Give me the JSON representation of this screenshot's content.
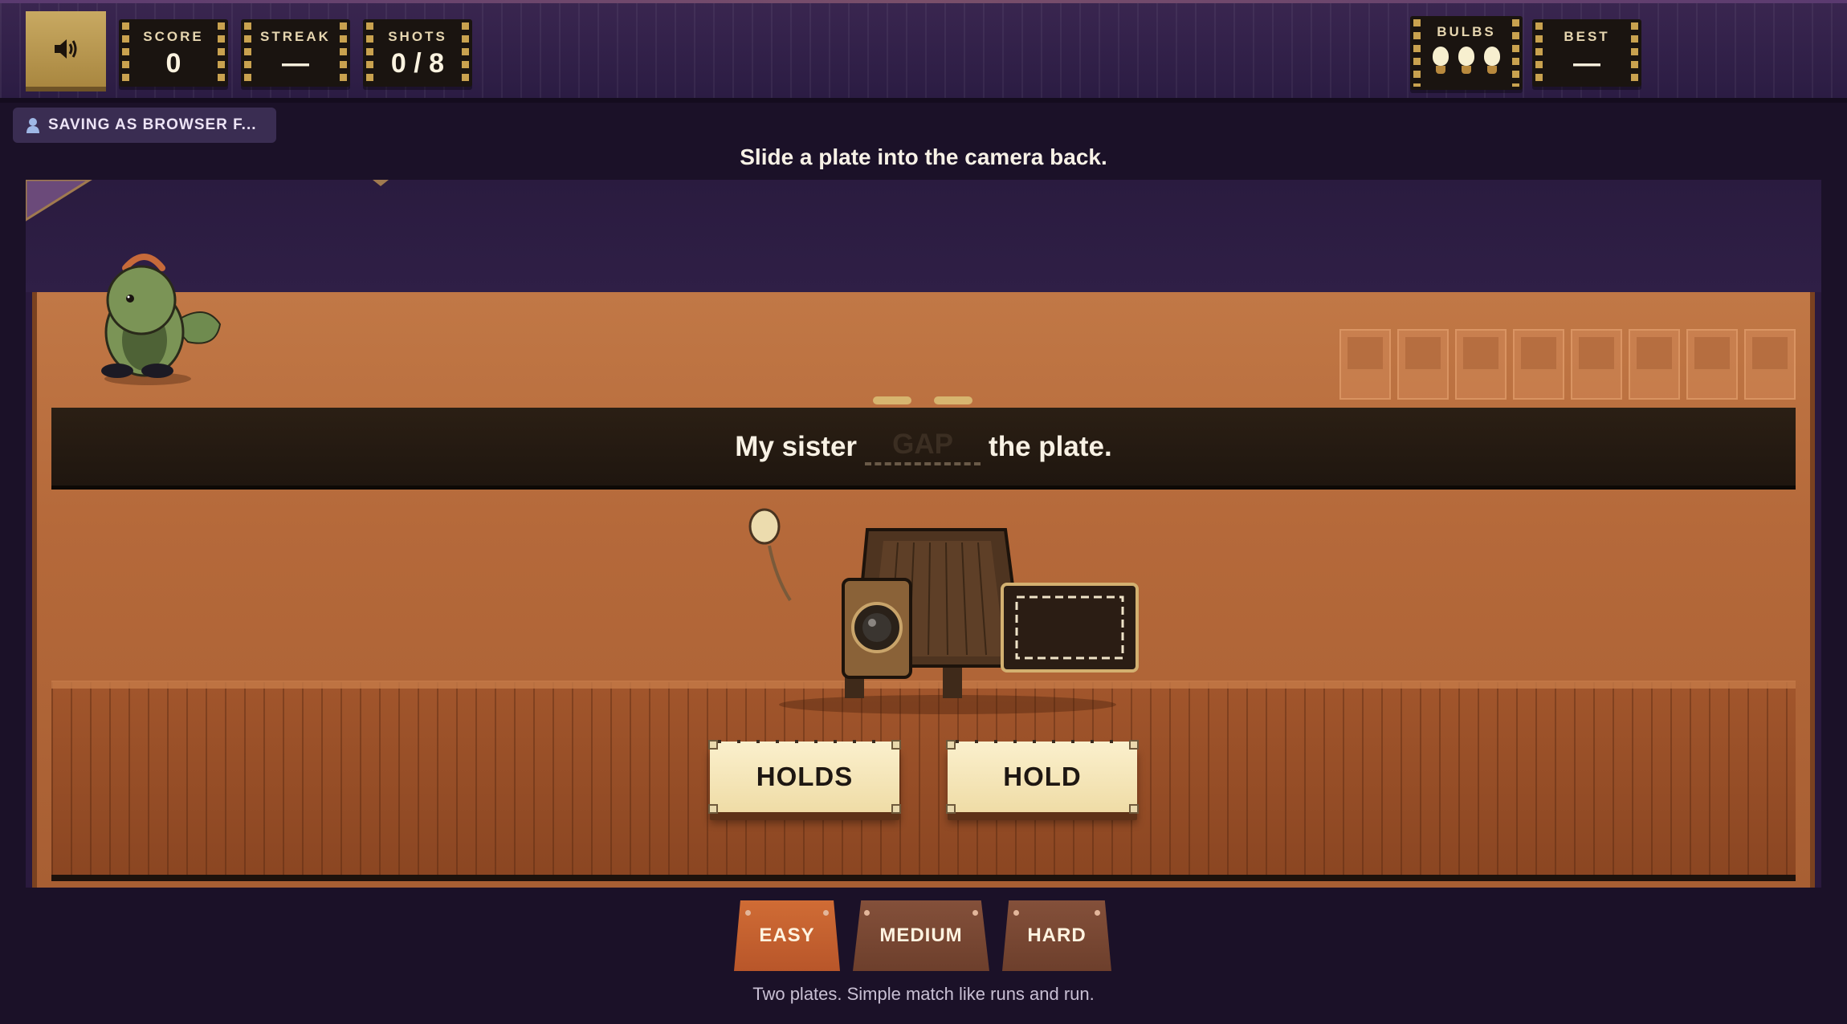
{
  "hud": {
    "score_label": "SCORE",
    "score_value": "0",
    "streak_label": "STREAK",
    "streak_value": "—",
    "shots_label": "SHOTS",
    "shots_value": "0 / 8",
    "bulbs_label": "BULBS",
    "bulbs_count": 3,
    "best_label": "BEST",
    "best_value": "—",
    "sound_icon": "speaker-icon"
  },
  "profile": {
    "saving_label": "SAVING AS BROWSER F..."
  },
  "instruction": "Slide a plate into the camera back.",
  "sentence": {
    "before": "My sister",
    "gap": "GAP",
    "after": "the plate."
  },
  "shot_slots": {
    "total": 8,
    "filled": 0
  },
  "choices": [
    {
      "label": "HOLDS"
    },
    {
      "label": "HOLD"
    }
  ],
  "difficulty": {
    "options": [
      {
        "label": "EASY",
        "selected": true
      },
      {
        "label": "MEDIUM",
        "selected": false
      },
      {
        "label": "HARD",
        "selected": false
      }
    ],
    "hint": "Two plates. Simple match like runs and run."
  },
  "colors": {
    "background": "#1b1128",
    "wall": "#c17846",
    "plate": "#fbf0cd",
    "easy_active": "#c9652f",
    "inactive_tab": "#7a4a30"
  }
}
